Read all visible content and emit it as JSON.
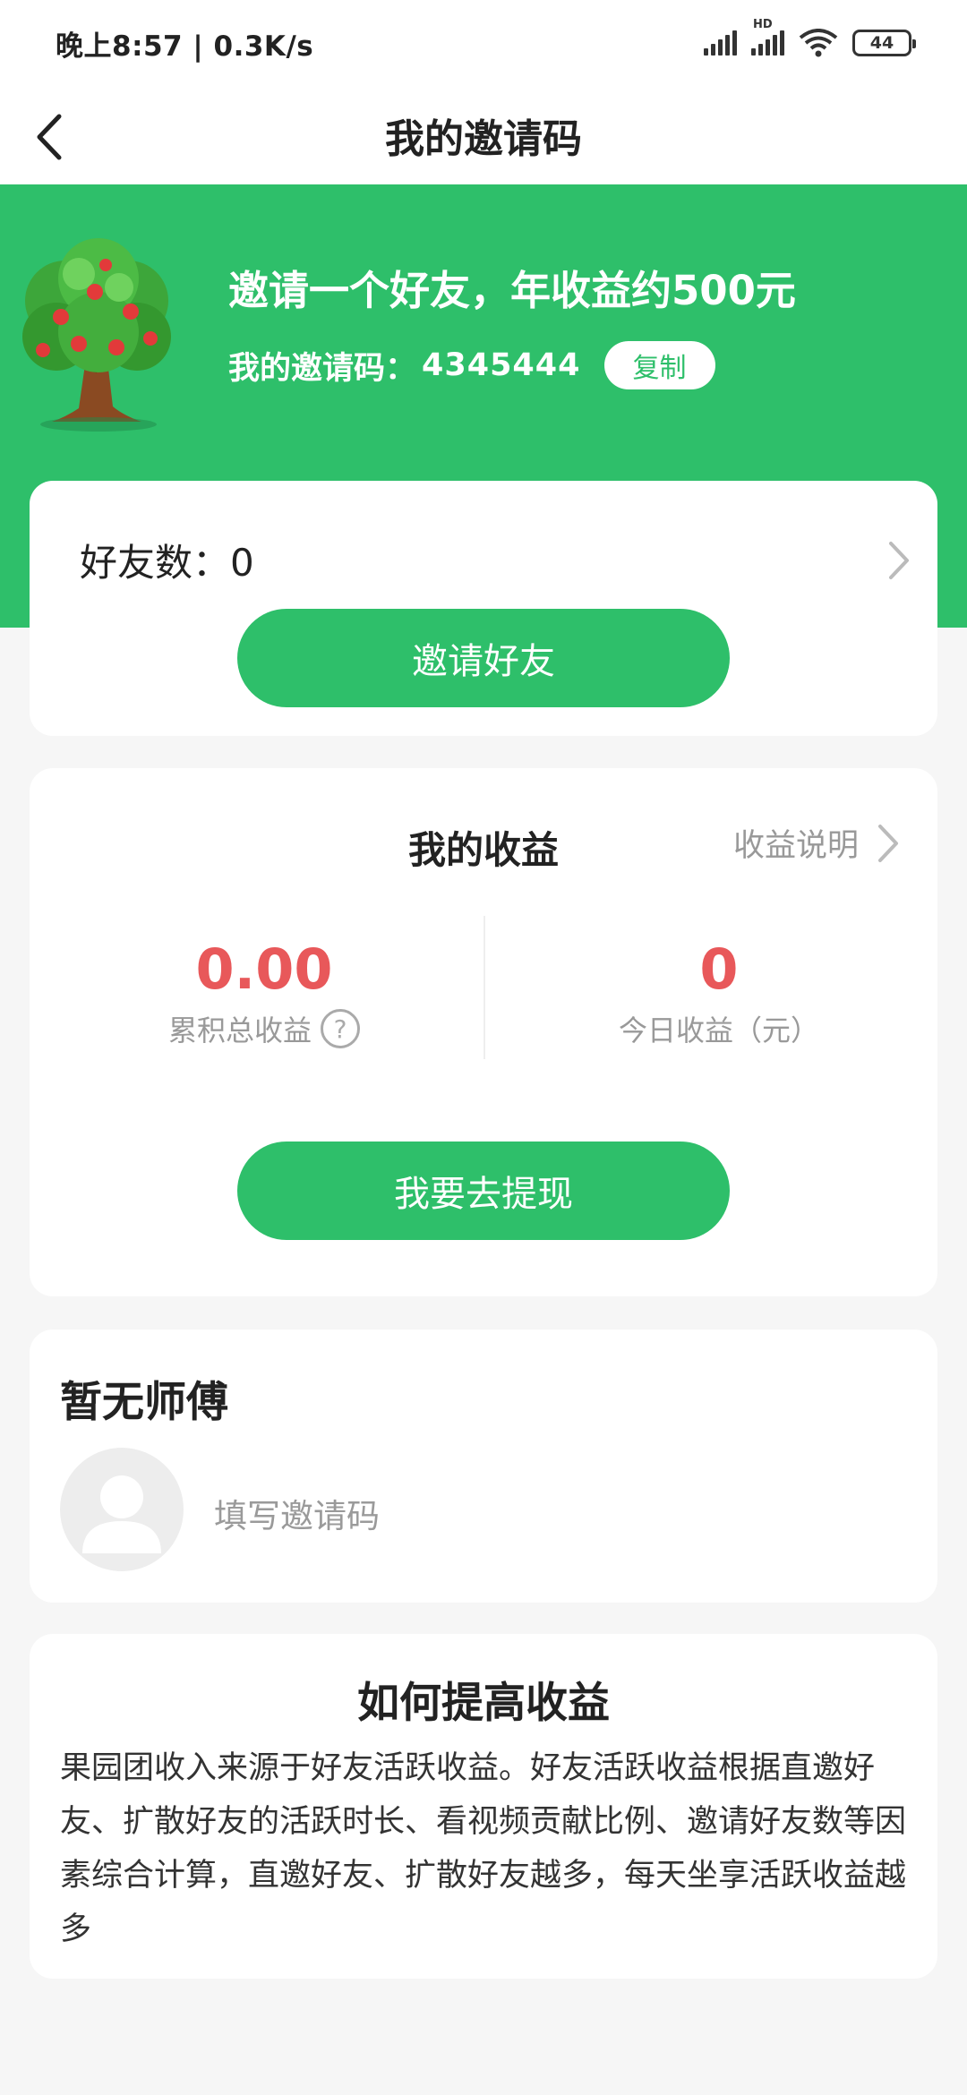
{
  "status_bar": {
    "time_speed": "晚上8:57 | 0.3K/s",
    "hd_label": "HD",
    "battery": "44"
  },
  "header": {
    "title": "我的邀请码",
    "back_icon": "back-arrow-icon"
  },
  "banner": {
    "headline": "邀请一个好友，年收益约500元",
    "invite_label": "我的邀请码：",
    "invite_code": "4345444",
    "copy_label": "复制",
    "background_color": "#2ebf6a",
    "tree_icon": "apple-tree-icon"
  },
  "friends": {
    "count_text": "好友数：0",
    "invite_button": "邀请好友"
  },
  "earnings": {
    "title": "我的收益",
    "explain_link": "收益说明",
    "total_value": "0.00",
    "total_label": "累积总收益",
    "today_value": "0",
    "today_label": "今日收益（元）",
    "withdraw_button": "我要去提现",
    "value_color": "#e8585a"
  },
  "master": {
    "title": "暂无师傅",
    "fill_code": "填写邀请码"
  },
  "tips": {
    "title": "如何提高收益",
    "body": "果园团收入来源于好友活跃收益。好友活跃收益根据直邀好友、扩散好友的活跃时长、看视频贡献比例、邀请好友数等因素综合计算，直邀好友、扩散好友越多，每天坐享活跃收益越多"
  }
}
